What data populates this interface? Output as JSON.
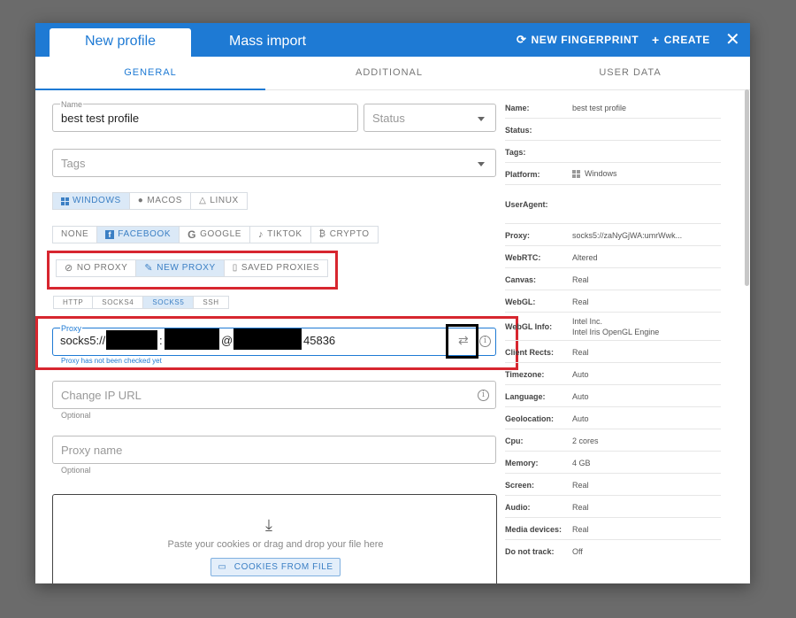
{
  "header": {
    "tab_new_profile": "New profile",
    "tab_mass_import": "Mass import",
    "new_fingerprint": "NEW FINGERPRINT",
    "create": "CREATE",
    "close": "✕"
  },
  "subtabs": [
    "GENERAL",
    "ADDITIONAL",
    "USER DATA"
  ],
  "form": {
    "name_label": "Name",
    "name_value": "best test profile",
    "status_placeholder": "Status",
    "tags_placeholder": "Tags",
    "os_options": [
      "WINDOWS",
      "MACOS",
      "LINUX"
    ],
    "os_selected": "WINDOWS",
    "platform_options": [
      "NONE",
      "FACEBOOK",
      "GOOGLE",
      "TIKTOK",
      "CRYPTO"
    ],
    "platform_selected": "FACEBOOK",
    "proxy_mode_options": [
      "NO PROXY",
      "NEW PROXY",
      "SAVED PROXIES"
    ],
    "proxy_mode_selected": "NEW PROXY",
    "proxy_type_options": [
      "HTTP",
      "SOCKS4",
      "SOCKS5",
      "SSH"
    ],
    "proxy_type_selected": "SOCKS5",
    "proxy_label": "Proxy",
    "proxy_value_prefix": "socks5://",
    "proxy_sep_colon": ":",
    "proxy_sep_at": "@",
    "proxy_value_suffix": "45836",
    "proxy_check_status": "Proxy has not been checked yet",
    "change_ip_placeholder": "Change IP URL",
    "change_ip_helper": "Optional",
    "proxy_name_placeholder": "Proxy name",
    "proxy_name_helper": "Optional",
    "cookies_hint": "Paste your cookies or drag and drop your file here",
    "cookies_button": "COOKIES FROM FILE"
  },
  "summary": [
    {
      "label": "Name:",
      "value": "best test profile"
    },
    {
      "label": "Status:",
      "value": ""
    },
    {
      "label": "Tags:",
      "value": ""
    },
    {
      "label": "Platform:",
      "value": "Windows"
    },
    {
      "label": "UserAgent:",
      "value": ""
    },
    {
      "label": "Proxy:",
      "value": "socks5://zaNyGjWA:umrWwk..."
    },
    {
      "label": "WebRTC:",
      "value": "Altered"
    },
    {
      "label": "Canvas:",
      "value": "Real"
    },
    {
      "label": "WebGL:",
      "value": "Real"
    },
    {
      "label": "WebGL Info:",
      "value": "Intel Inc.",
      "value2": "Intel Iris OpenGL Engine"
    },
    {
      "label": "Client Rects:",
      "value": "Real"
    },
    {
      "label": "Timezone:",
      "value": "Auto"
    },
    {
      "label": "Language:",
      "value": "Auto"
    },
    {
      "label": "Geolocation:",
      "value": "Auto"
    },
    {
      "label": "Cpu:",
      "value": "2 cores"
    },
    {
      "label": "Memory:",
      "value": "4 GB"
    },
    {
      "label": "Screen:",
      "value": "Real"
    },
    {
      "label": "Audio:",
      "value": "Real"
    },
    {
      "label": "Media devices:",
      "value": "Real"
    },
    {
      "label": "Do not track:",
      "value": "Off"
    }
  ],
  "colors": {
    "primary": "#1e7ad4",
    "active_segment_bg": "#dbe9f7",
    "highlight_red": "#d7262f"
  }
}
